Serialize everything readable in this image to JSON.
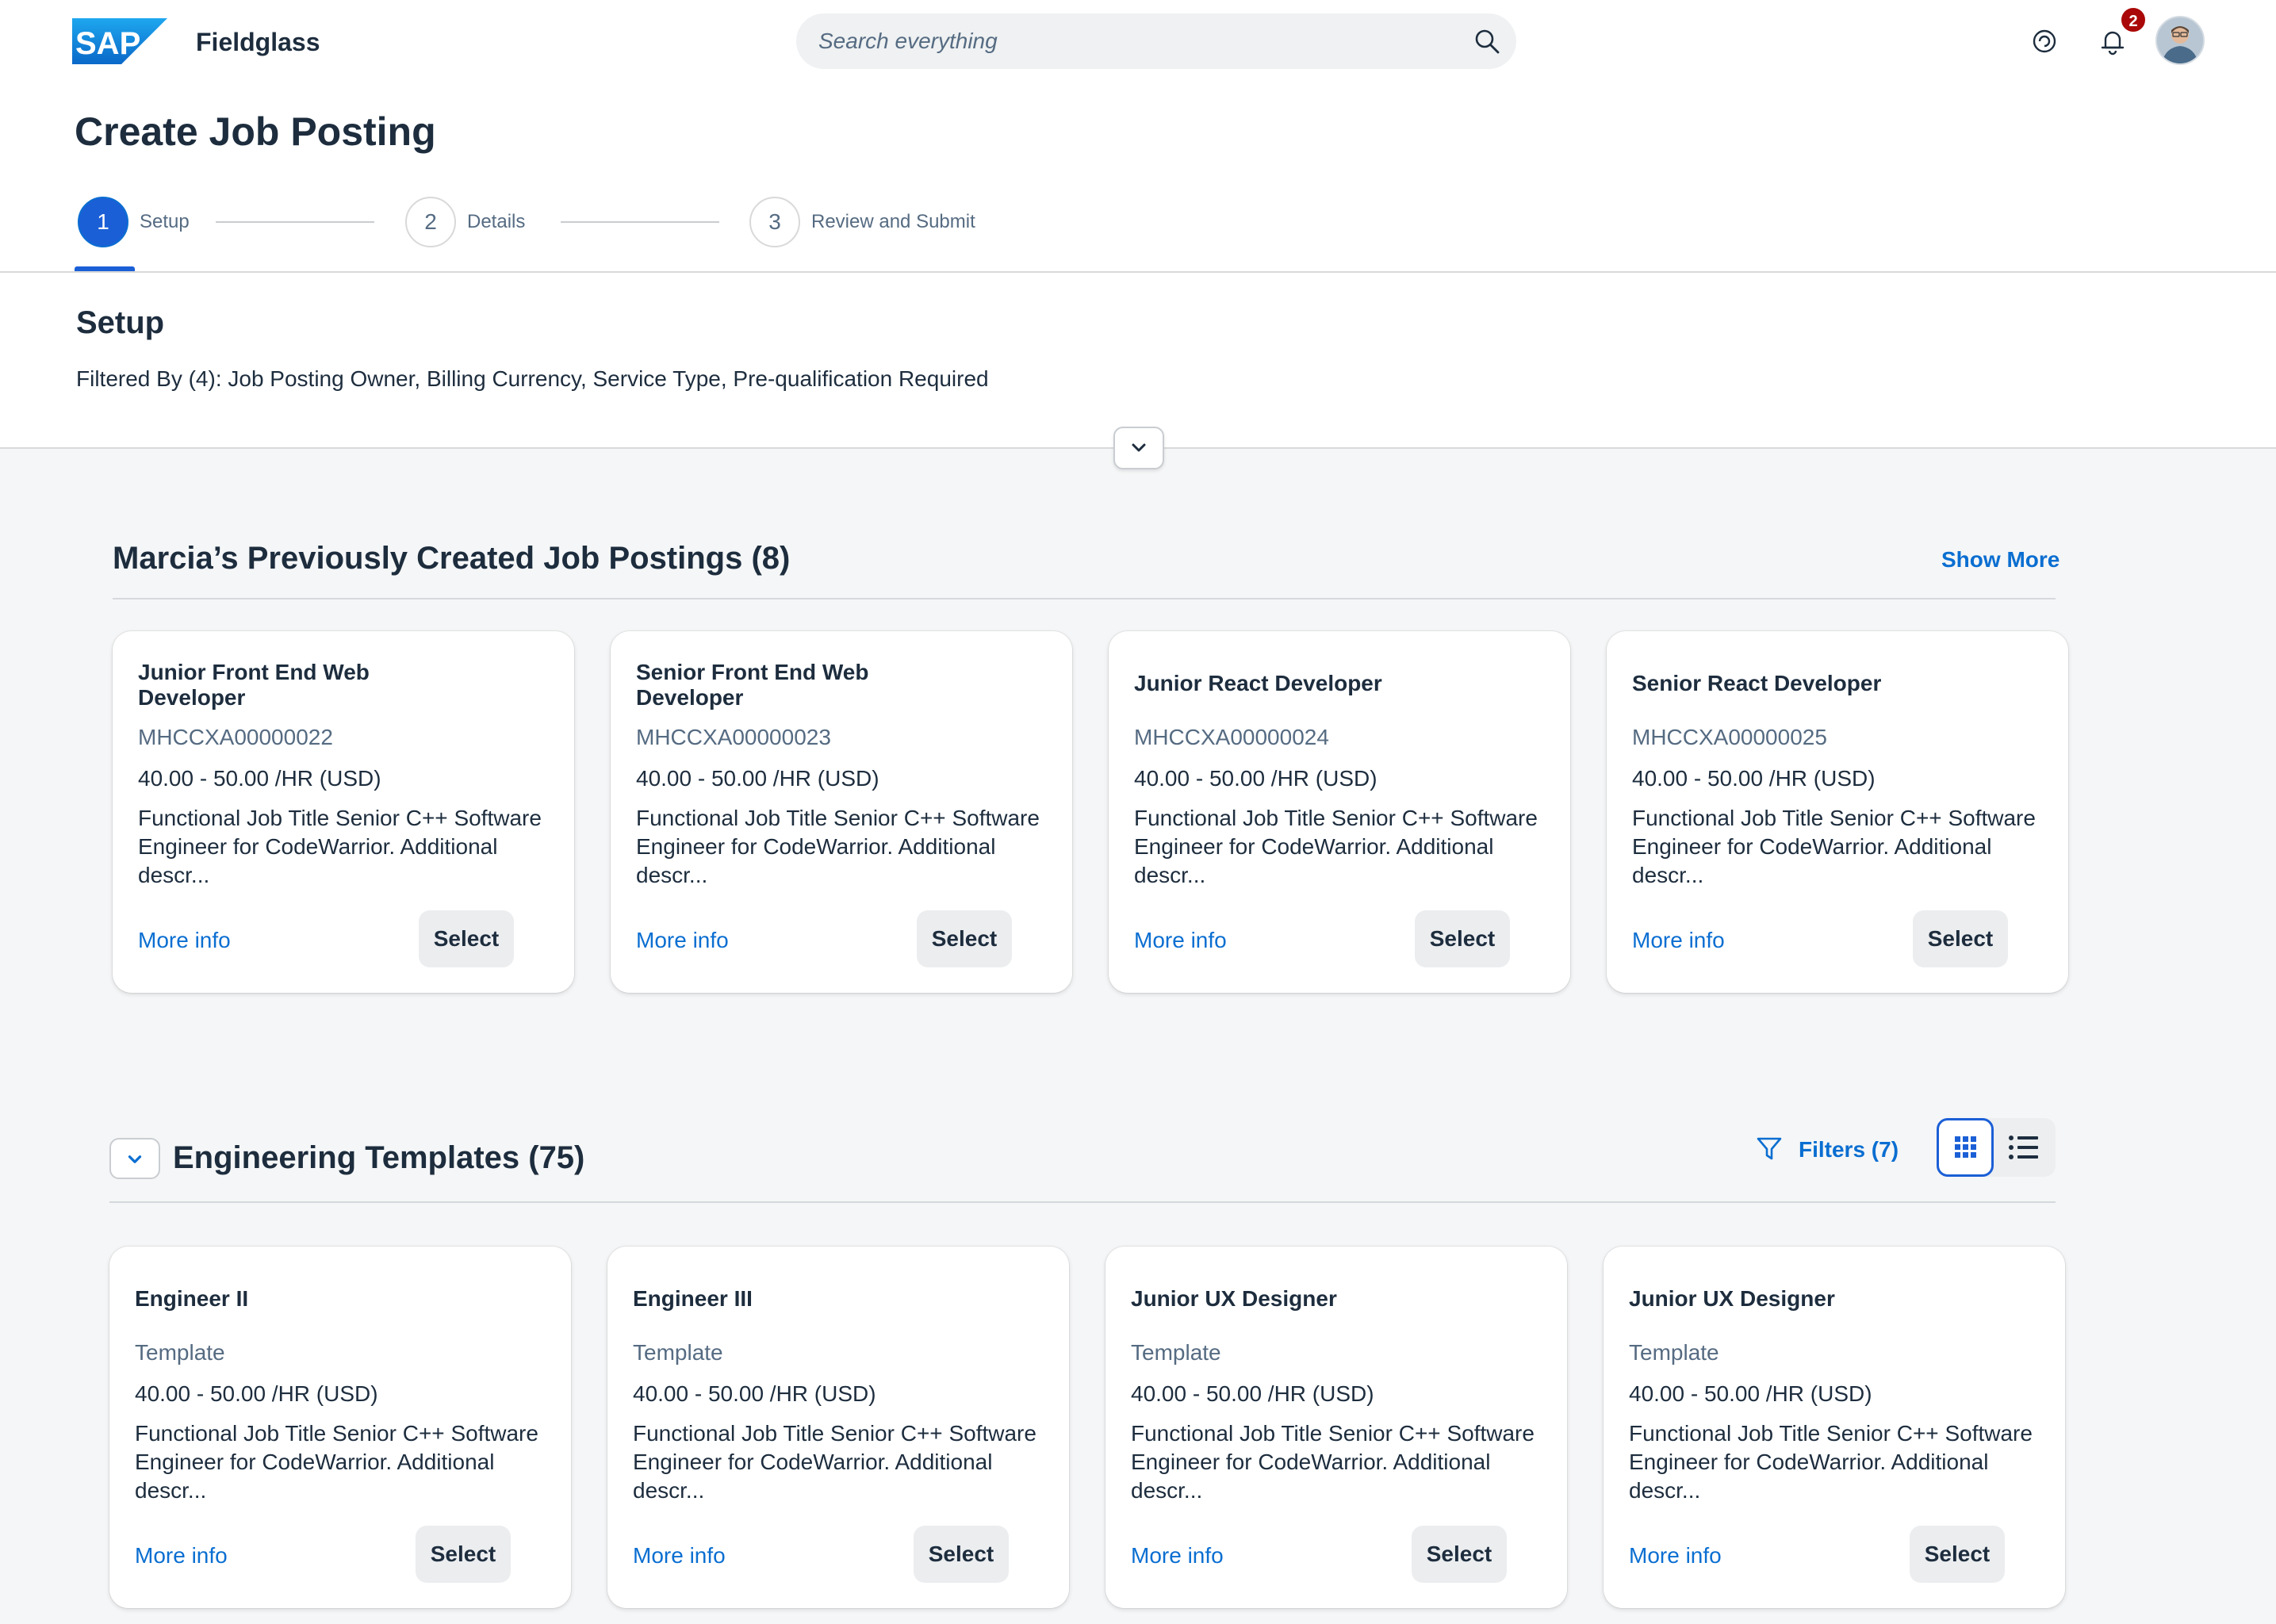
{
  "shell": {
    "logo_text": "SAP",
    "product_name": "Fieldglass",
    "search_placeholder": "Search everything",
    "notification_count": "2",
    "icons": [
      "sap-logo",
      "search-icon",
      "joule-icon",
      "bell-icon",
      "user-avatar"
    ]
  },
  "page": {
    "title": "Create Job Posting",
    "steps": [
      {
        "number": "1",
        "label": "Setup",
        "active": true
      },
      {
        "number": "2",
        "label": "Details",
        "active": false
      },
      {
        "number": "3",
        "label": "Review and Submit",
        "active": false
      }
    ]
  },
  "setup": {
    "title": "Setup",
    "filter_text": "Filtered By (4): Job Posting Owner, Billing Currency, Service Type, Pre-qualification Required"
  },
  "previous": {
    "title": "Marcia’s Previously Created Job Postings (8)",
    "show_more": "Show More",
    "cards": [
      {
        "title": "Junior Front End Web Developer",
        "subtitle": "MHCCXA00000022",
        "rate": "40.00 - 50.00 /HR (USD)",
        "description": "Functional Job Title Senior C++ Software Engineer for CodeWarrior. Additional descr...",
        "more": "More info",
        "select": "Select"
      },
      {
        "title": "Senior Front End Web Developer",
        "subtitle": "MHCCXA00000023",
        "rate": "40.00 - 50.00 /HR (USD)",
        "description": "Functional Job Title Senior C++ Software Engineer for CodeWarrior. Additional descr...",
        "more": "More info",
        "select": "Select"
      },
      {
        "title": "Junior React Developer",
        "subtitle": "MHCCXA00000024",
        "rate": "40.00 - 50.00 /HR (USD)",
        "description": "Functional Job Title Senior C++ Software Engineer for CodeWarrior. Additional descr...",
        "more": "More info",
        "select": "Select"
      },
      {
        "title": "Senior React Developer",
        "subtitle": "MHCCXA00000025",
        "rate": "40.00 - 50.00 /HR (USD)",
        "description": "Functional Job Title Senior C++ Software Engineer for CodeWarrior. Additional descr...",
        "more": "More info",
        "select": "Select"
      }
    ]
  },
  "templates": {
    "title": "Engineering Templates (75)",
    "filters_label": "Filters (7)",
    "view_mode": "grid",
    "cards": [
      {
        "title": "Engineer II",
        "subtitle": "Template",
        "rate": "40.00 - 50.00 /HR (USD)",
        "description": "Functional Job Title Senior C++ Software Engineer for CodeWarrior. Additional descr...",
        "more": "More info",
        "select": "Select"
      },
      {
        "title": "Engineer III",
        "subtitle": "Template",
        "rate": "40.00 - 50.00 /HR (USD)",
        "description": "Functional Job Title Senior C++ Software Engineer for CodeWarrior. Additional descr...",
        "more": "More info",
        "select": "Select"
      },
      {
        "title": "Junior UX Designer",
        "subtitle": "Template",
        "rate": "40.00 - 50.00 /HR (USD)",
        "description": "Functional Job Title Senior C++ Software Engineer for CodeWarrior. Additional descr...",
        "more": "More info",
        "select": "Select"
      },
      {
        "title": "Junior UX Designer",
        "subtitle": "Template",
        "rate": "40.00 - 50.00 /HR (USD)",
        "description": "Functional Job Title Senior C++ Software Engineer for CodeWarrior. Additional descr...",
        "more": "More info",
        "select": "Select"
      }
    ]
  },
  "colors": {
    "brand_blue": "#1b5fd6",
    "link_blue": "#0a6ed1",
    "badge_red": "#aa0808",
    "page_background": "#f5f6f7",
    "text": "#1d2d3e"
  }
}
